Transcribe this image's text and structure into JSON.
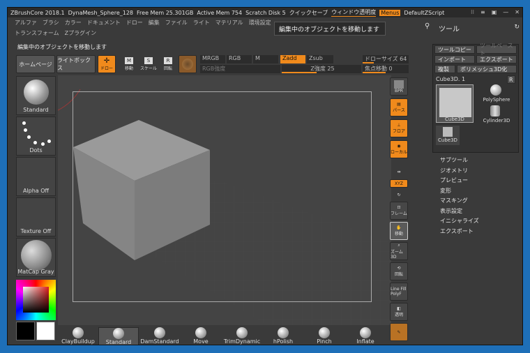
{
  "topbar": {
    "app": "ZBrushCore 2018.1",
    "file": "DynaMesh_Sphere_128",
    "free_mem": "Free Mem 25.301GB",
    "active_mem": "Active Mem 754",
    "scratch": "Scratch Disk 5",
    "quicksave": "クイックセーブ",
    "transparency": "ウィンドウ透明度",
    "menus": "Menus",
    "script": "DefaultZScript"
  },
  "menus": {
    "row1": [
      "アルファ",
      "ブラシ",
      "カラー",
      "ドキュメント",
      "ドロー",
      "編集",
      "ファイル",
      "ライト",
      "マテリアル",
      "環境設定"
    ],
    "row2": [
      "トランスフォーム",
      "Zプラグイン"
    ]
  },
  "tooltip": "編集中のオブジェクトを移動します",
  "status_note": "編集中のオブジェクトを移動します",
  "toolbar": {
    "home": "ホームページ",
    "lightbox": "ライトボックス",
    "draw": "ドロー",
    "move": "移動",
    "scale": "スケール",
    "rotate": "回転",
    "mrgb": "MRGB",
    "rgb": "RGB",
    "m": "M",
    "zadd": "Zadd",
    "zsub": "Zsub",
    "rgb_intensity": "RGB強度",
    "z_intensity": "Z強度 25",
    "draw_size": "ドローサイズ 64",
    "focal": "焦点移動 0"
  },
  "left": {
    "standard": "Standard",
    "dots": "Dots",
    "alpha": "Alpha Off",
    "texture": "Texture Off",
    "matcap": "MatCap Gray"
  },
  "right_toolbar": {
    "bpr": "BPR",
    "perspective": "パース",
    "floor": "フロア",
    "local": "ローカル",
    "xyz": "XYZ",
    "frame": "フレーム",
    "move": "移動",
    "zoom": "ズーム3D",
    "rotate": "回転",
    "polyf": "Line Fill PolyF",
    "transp": "透明"
  },
  "tool_panel": {
    "title": "ツール",
    "copy": "ツールコピー",
    "paste": "ツールペースト",
    "import": "インポート",
    "export": "エクスポート",
    "clone": "複製",
    "polymesh": "ポリメッシュ3D化",
    "current": "Cube3D. 1",
    "r": "R",
    "cube": "Cube3D",
    "polysphere": "PolySphere",
    "cylinder": "Cylinder3D",
    "cube2": "Cube3D",
    "subpanels": [
      "サブツール",
      "ジオメトリ",
      "プレビュー",
      "変形",
      "マスキング",
      "表示設定",
      "イニシャライズ",
      "エクスポート"
    ]
  },
  "brushes": [
    "ClayBuildup",
    "Standard",
    "DamStandard",
    "Move",
    "TrimDynamic",
    "hPolish",
    "Pinch",
    "Inflate"
  ],
  "colors": {
    "accent": "#f08a1c",
    "bg": "#3a3a3a"
  }
}
